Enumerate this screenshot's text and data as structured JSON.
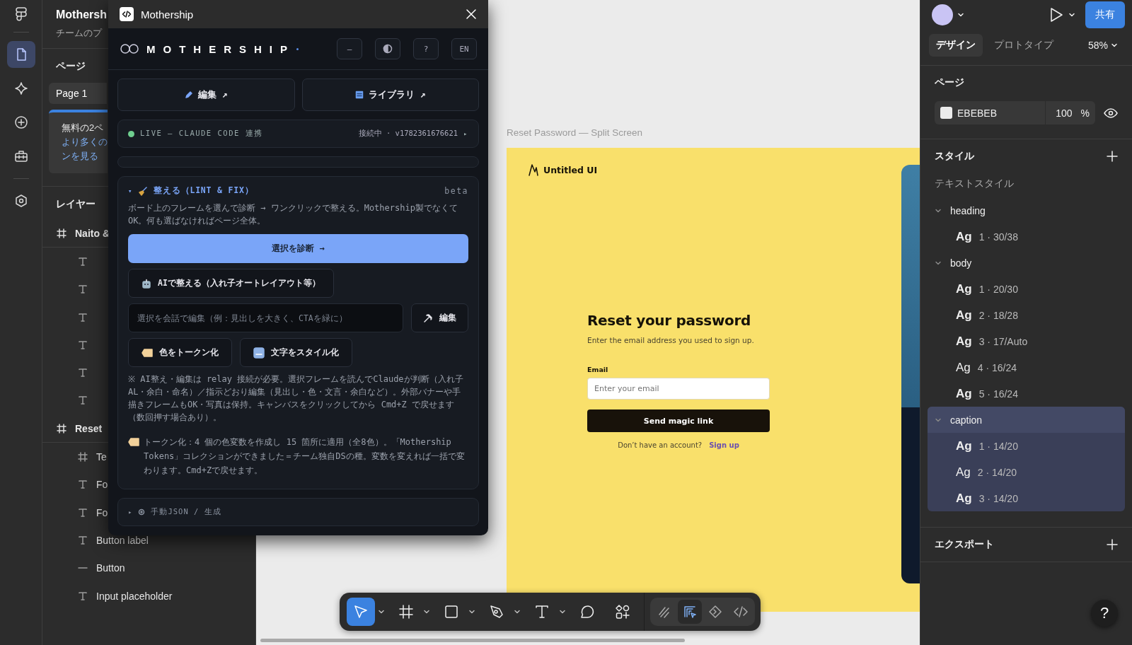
{
  "rail": {
    "items": [
      {
        "kind": "pages",
        "selected": true
      },
      {
        "kind": "assets",
        "selected": false
      },
      {
        "kind": "insert",
        "selected": false
      },
      {
        "kind": "plugins",
        "selected": false
      },
      {
        "kind": "settings",
        "selected": false
      }
    ]
  },
  "left_panel": {
    "file_title": "Mothersh",
    "file_subtitle": "チームのプ",
    "pages_heading": "ページ",
    "pages": [
      {
        "name": "Page 1",
        "selected": true
      }
    ],
    "promo": {
      "text": "無料の2ペ",
      "link_lines": [
        "より多くの",
        "ンを見る"
      ]
    },
    "layers_heading": "レイヤー",
    "layers": [
      {
        "kind": "frame",
        "name": "Naito &",
        "children": [
          {
            "kind": "text"
          },
          {
            "kind": "text"
          },
          {
            "kind": "text"
          },
          {
            "kind": "text"
          },
          {
            "kind": "text"
          },
          {
            "kind": "text"
          }
        ]
      },
      {
        "kind": "frame",
        "name": "Reset",
        "children": [
          {
            "kind": "frame",
            "name": "Te"
          },
          {
            "kind": "text",
            "name": "Fo"
          },
          {
            "kind": "text",
            "name": "Fo"
          },
          {
            "kind": "text",
            "name": "Button label"
          },
          {
            "kind": "line",
            "name": "Button"
          },
          {
            "kind": "text",
            "name": "Input placeholder"
          }
        ]
      }
    ]
  },
  "plugin": {
    "title": "Mothership",
    "brand": "MOTHERSHIP",
    "header_buttons": [
      {
        "kind": "text",
        "label": "—"
      },
      {
        "kind": "contrast"
      },
      {
        "kind": "text",
        "label": "?"
      },
      {
        "kind": "text",
        "label": "EN"
      }
    ],
    "links": [
      {
        "kind": "pencil",
        "label": "編集 ↗"
      },
      {
        "kind": "library",
        "label": "ライブラリ ↗"
      }
    ],
    "live": {
      "on": true,
      "label": "LIVE — CLAUDE CODE 連携",
      "status": "接続中 · v1782361676621",
      "toggle": "▸"
    },
    "lint": {
      "expanded": true,
      "toggle": "▾",
      "title": "整える（LINT & FIX）",
      "badge": "beta",
      "description": "ボード上のフレームを選んで診断 → ワンクリックで整える。Mothership製でなくてOK。何も選ばなければページ全体。",
      "primary_button": "選択を診断 →",
      "ai_button": "AIで整える（入れ子オートレイアウト等）",
      "edit_field": {
        "placeholder": "選択を会話で編集（例：見出しを大きく、CTAを緑に）"
      },
      "edit_button": "編集",
      "token_buttons": [
        {
          "kind": "tag",
          "label": "色をトークン化"
        },
        {
          "kind": "abc",
          "label": "文字をスタイル化"
        }
      ],
      "note": "※ AI整え・編集は relay 接続が必要。選択フレームを読んでClaudeが判断（入れ子AL・余白・命名）／指示どおり編集（見出し・色・文言・余白など）。外部バナーや手描きフレームもOK・写真は保持。キャンバスをクリックしてから Cmd+Z で戻せます（数回押す場合あり）。",
      "result": "トークン化：4 個の色変数を作成し 15 箇所に適用（全8色）。「Mothership Tokens」コレクションができました＝チーム独自DSの種。変数を変えれば一括で変わります。Cmd+Zで戻せます。"
    },
    "manual": {
      "expanded": false,
      "toggle": "▸",
      "label": "手動JSON / 生成"
    }
  },
  "canvas": {
    "frame_label": "Reset Password — Split Screen",
    "logo": "Untitled UI",
    "heading": "Reset your password",
    "subtitle": "Enter the email address you used to sign up.",
    "email_label": "Email",
    "email_field": {
      "placeholder": "Enter your email"
    },
    "submit_button": "Send magic link",
    "signup_prompt": "Don’t have an account?",
    "signup_link": "Sign up"
  },
  "toolbar": {
    "tools": [
      {
        "kind": "move",
        "selected": true,
        "dropdown": true
      },
      {
        "kind": "frame",
        "selected": false,
        "dropdown": true
      },
      {
        "kind": "rectangle",
        "selected": false,
        "dropdown": true
      },
      {
        "kind": "pen",
        "selected": false,
        "dropdown": true
      },
      {
        "kind": "text",
        "selected": false,
        "dropdown": true
      },
      {
        "kind": "comment",
        "selected": false,
        "dropdown": false
      },
      {
        "kind": "actions",
        "selected": false,
        "dropdown": false
      }
    ],
    "modes": [
      {
        "kind": "draw",
        "selected": false
      },
      {
        "kind": "design",
        "selected": true
      },
      {
        "kind": "dev",
        "selected": false
      },
      {
        "kind": "code",
        "selected": false
      }
    ]
  },
  "right_panel": {
    "share_button": "共有",
    "tabs": [
      {
        "label": "デザイン",
        "selected": true
      },
      {
        "label": "プロトタイプ",
        "selected": false
      }
    ],
    "zoom": "58%",
    "page_heading": "ページ",
    "page_color": "EBEBEB",
    "page_opacity": "100",
    "opacity_unit": "%",
    "styles_heading": "スタイル",
    "text_styles_label": "テキストスタイル",
    "style_groups": [
      {
        "name": "heading",
        "expanded": true,
        "selected": false,
        "items": [
          {
            "sample": "Ag",
            "kind": "strong",
            "label": "1 · 30/38"
          }
        ]
      },
      {
        "name": "body",
        "expanded": true,
        "selected": false,
        "items": [
          {
            "sample": "Ag",
            "kind": "strong",
            "label": "1 · 20/30"
          },
          {
            "sample": "Ag",
            "kind": "strong",
            "label": "2 · 18/28"
          },
          {
            "sample": "Ag",
            "kind": "strong",
            "label": "3 · 17/Auto"
          },
          {
            "sample": "Ag",
            "kind": "plain",
            "label": "4 · 16/24"
          },
          {
            "sample": "Ag",
            "kind": "strong",
            "label": "5 · 16/24"
          }
        ]
      },
      {
        "name": "caption",
        "expanded": true,
        "selected": true,
        "items": [
          {
            "sample": "Ag",
            "kind": "strong",
            "label": "1 · 14/20"
          },
          {
            "sample": "Ag",
            "kind": "plain",
            "label": "2 · 14/20"
          },
          {
            "sample": "Ag",
            "kind": "strong",
            "label": "3 · 14/20"
          }
        ]
      }
    ],
    "export_heading": "エクスポート",
    "help_button": "?"
  }
}
